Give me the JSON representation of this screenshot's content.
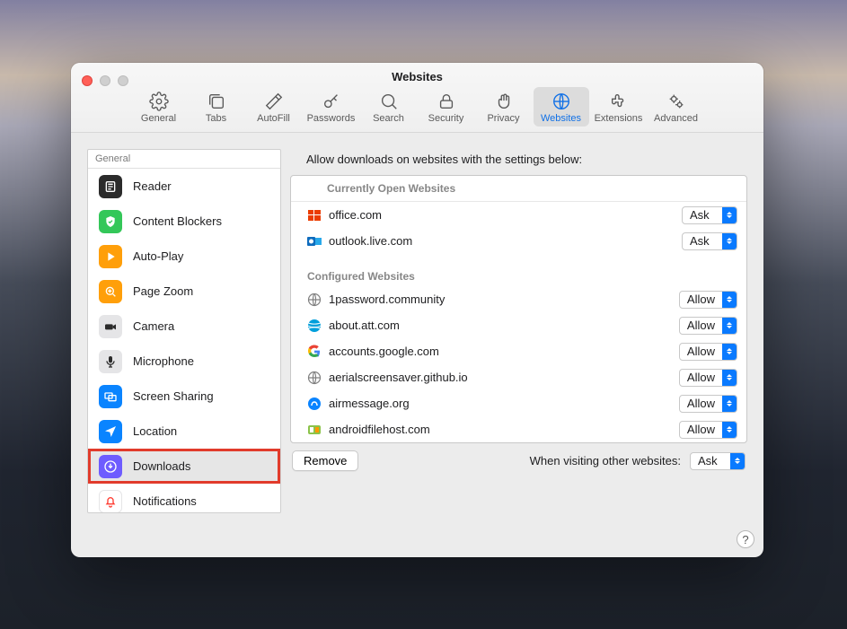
{
  "window": {
    "title": "Websites"
  },
  "toolbar": {
    "items": [
      {
        "id": "general",
        "label": "General"
      },
      {
        "id": "tabs",
        "label": "Tabs"
      },
      {
        "id": "autofill",
        "label": "AutoFill"
      },
      {
        "id": "passwords",
        "label": "Passwords"
      },
      {
        "id": "search",
        "label": "Search"
      },
      {
        "id": "security",
        "label": "Security"
      },
      {
        "id": "privacy",
        "label": "Privacy"
      },
      {
        "id": "websites",
        "label": "Websites",
        "selected": true
      },
      {
        "id": "extensions",
        "label": "Extensions"
      },
      {
        "id": "advanced",
        "label": "Advanced"
      }
    ]
  },
  "sidebar": {
    "header": "General",
    "items": [
      {
        "id": "reader",
        "label": "Reader",
        "icon": "reader-icon",
        "color": "#2b2b2b"
      },
      {
        "id": "contentblockers",
        "label": "Content Blockers",
        "icon": "shield-icon",
        "color": "#34c759"
      },
      {
        "id": "autoplay",
        "label": "Auto-Play",
        "icon": "play-icon",
        "color": "#ff9f0a"
      },
      {
        "id": "pagezoom",
        "label": "Page Zoom",
        "icon": "zoom-icon",
        "color": "#ff9f0a"
      },
      {
        "id": "camera",
        "label": "Camera",
        "icon": "camera-icon",
        "color": "#e5e5e7",
        "fg": "#2b2b2b"
      },
      {
        "id": "microphone",
        "label": "Microphone",
        "icon": "mic-icon",
        "color": "#e5e5e7",
        "fg": "#2b2b2b"
      },
      {
        "id": "screensharing",
        "label": "Screen Sharing",
        "icon": "screens-icon",
        "color": "#0a84ff"
      },
      {
        "id": "location",
        "label": "Location",
        "icon": "location-icon",
        "color": "#0a84ff"
      },
      {
        "id": "downloads",
        "label": "Downloads",
        "icon": "download-icon",
        "color": "#6e5cff",
        "highlighted": true
      },
      {
        "id": "notifications",
        "label": "Notifications",
        "icon": "bell-icon",
        "color": "#ffffff",
        "fg": "#ff3b30"
      }
    ]
  },
  "main": {
    "heading": "Allow downloads on websites with the settings below:",
    "open_sites_header": "Currently Open Websites",
    "open_sites": [
      {
        "name": "office.com",
        "icon": "office-icon",
        "value": "Ask"
      },
      {
        "name": "outlook.live.com",
        "icon": "outlook-icon",
        "value": "Ask"
      }
    ],
    "configured_header": "Configured Websites",
    "configured_sites": [
      {
        "name": "1password.community",
        "icon": "globe-icon",
        "value": "Allow"
      },
      {
        "name": "about.att.com",
        "icon": "att-icon",
        "value": "Allow"
      },
      {
        "name": "accounts.google.com",
        "icon": "google-icon",
        "value": "Allow"
      },
      {
        "name": "aerialscreensaver.github.io",
        "icon": "globe-icon",
        "value": "Allow"
      },
      {
        "name": "airmessage.org",
        "icon": "air-icon",
        "value": "Allow"
      },
      {
        "name": "androidfilehost.com",
        "icon": "afh-icon",
        "value": "Allow"
      }
    ],
    "remove_button": "Remove",
    "other_label": "When visiting other websites:",
    "other_value": "Ask"
  }
}
